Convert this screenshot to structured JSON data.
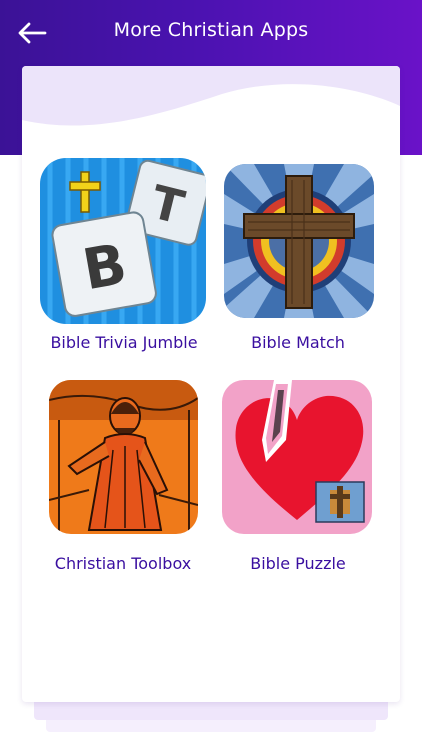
{
  "header": {
    "title": "More Christian Apps",
    "back_icon": "arrow-left-icon",
    "colors": {
      "gradient_start": "#3b1296",
      "gradient_end": "#6a12c8"
    }
  },
  "apps": [
    {
      "label": "Bible Trivia Jumble",
      "icon": "bible-trivia-jumble-icon"
    },
    {
      "label": "Bible Match",
      "icon": "cross-icon"
    },
    {
      "label": "Christian Toolbox",
      "icon": "jesus-figure-icon"
    },
    {
      "label": "Bible Puzzle",
      "icon": "heart-puzzle-icon"
    }
  ],
  "colors": {
    "label_text": "#3a0fa0",
    "card_wave": "#ece4fa"
  }
}
